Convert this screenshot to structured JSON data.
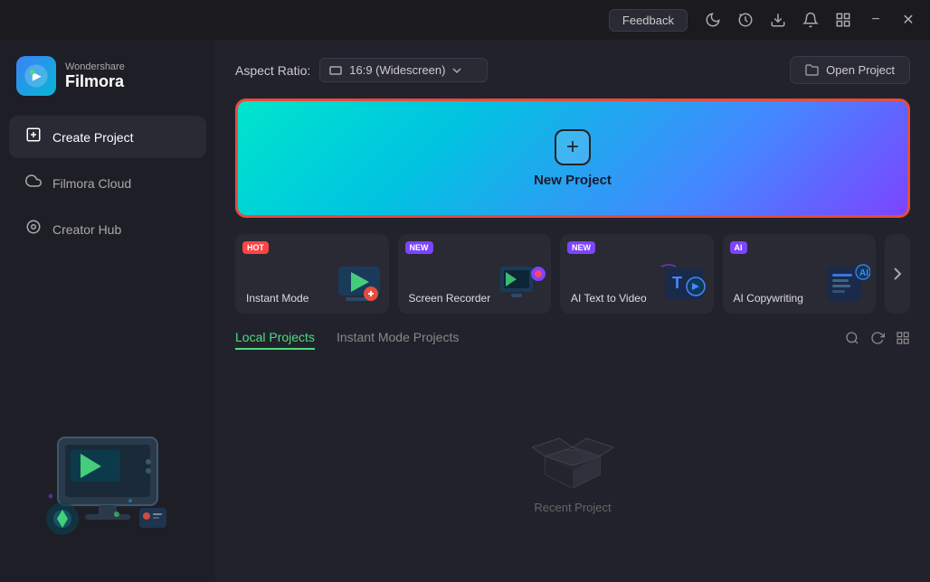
{
  "titlebar": {
    "feedback_label": "Feedback",
    "minimize_label": "−",
    "close_label": "✕"
  },
  "logo": {
    "sub": "Wondershare",
    "main": "Filmora"
  },
  "nav": {
    "items": [
      {
        "id": "create-project",
        "label": "Create Project",
        "icon": "⊞",
        "active": true
      },
      {
        "id": "filmora-cloud",
        "label": "Filmora Cloud",
        "icon": "☁",
        "active": false
      },
      {
        "id": "creator-hub",
        "label": "Creator Hub",
        "icon": "◎",
        "active": false
      }
    ]
  },
  "aspect_ratio": {
    "label": "Aspect Ratio:",
    "value": "16:9 (Widescreen)"
  },
  "open_project": {
    "label": "Open Project",
    "icon": "📁"
  },
  "new_project": {
    "label": "New Project",
    "plus": "+"
  },
  "quick_actions": [
    {
      "id": "instant-mode",
      "label": "Instant Mode",
      "badge": "HOT",
      "badge_type": "hot"
    },
    {
      "id": "screen-recorder",
      "label": "Screen Recorder",
      "badge": "NEW",
      "badge_type": "new"
    },
    {
      "id": "ai-text-to-video",
      "label": "AI Text to Video",
      "badge": "NEW",
      "badge_type": "new"
    },
    {
      "id": "ai-copywriting",
      "label": "AI Copywriting",
      "badge": "AI",
      "badge_type": "new"
    }
  ],
  "projects": {
    "tabs": [
      {
        "id": "local",
        "label": "Local Projects",
        "active": true
      },
      {
        "id": "instant",
        "label": "Instant Mode Projects",
        "active": false
      }
    ],
    "empty_label": "Recent Project"
  },
  "icons": {
    "search": "🔍",
    "refresh": "↻",
    "grid": "⊞",
    "chevron_right": "›",
    "folder": "🗂"
  }
}
